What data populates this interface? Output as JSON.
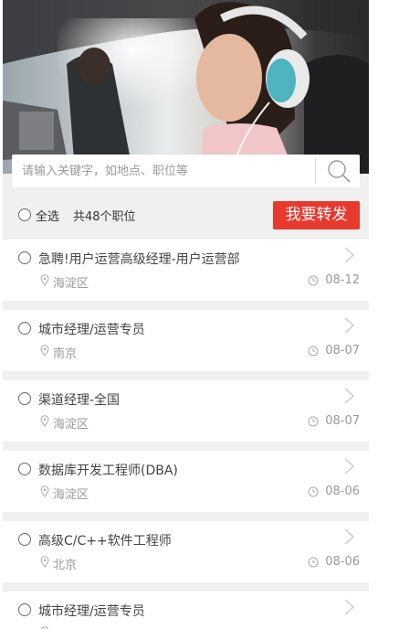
{
  "search": {
    "placeholder": "请输入关键字，如地点、职位等",
    "icon": "search-icon"
  },
  "toolbar": {
    "select_all_label": "全选",
    "total_text": "共48个职位",
    "forward_button": "我要转发"
  },
  "colors": {
    "accent": "#e8392e",
    "page_bg": "#f0f0f0",
    "meta_text": "#999999"
  },
  "jobs": [
    {
      "title": "急聘!用户运营高级经理-用户运营部",
      "location": "海淀区",
      "date": "08-12"
    },
    {
      "title": "城市经理/运营专员",
      "location": "南京",
      "date": "08-07"
    },
    {
      "title": "渠道经理-全国",
      "location": "海淀区",
      "date": "08-07"
    },
    {
      "title": "数据库开发工程师(DBA)",
      "location": "海淀区",
      "date": "08-06"
    },
    {
      "title": "高级C/C++软件工程师",
      "location": "北京",
      "date": "08-06"
    },
    {
      "title": "城市经理/运营专员",
      "location": "",
      "date": ""
    }
  ]
}
